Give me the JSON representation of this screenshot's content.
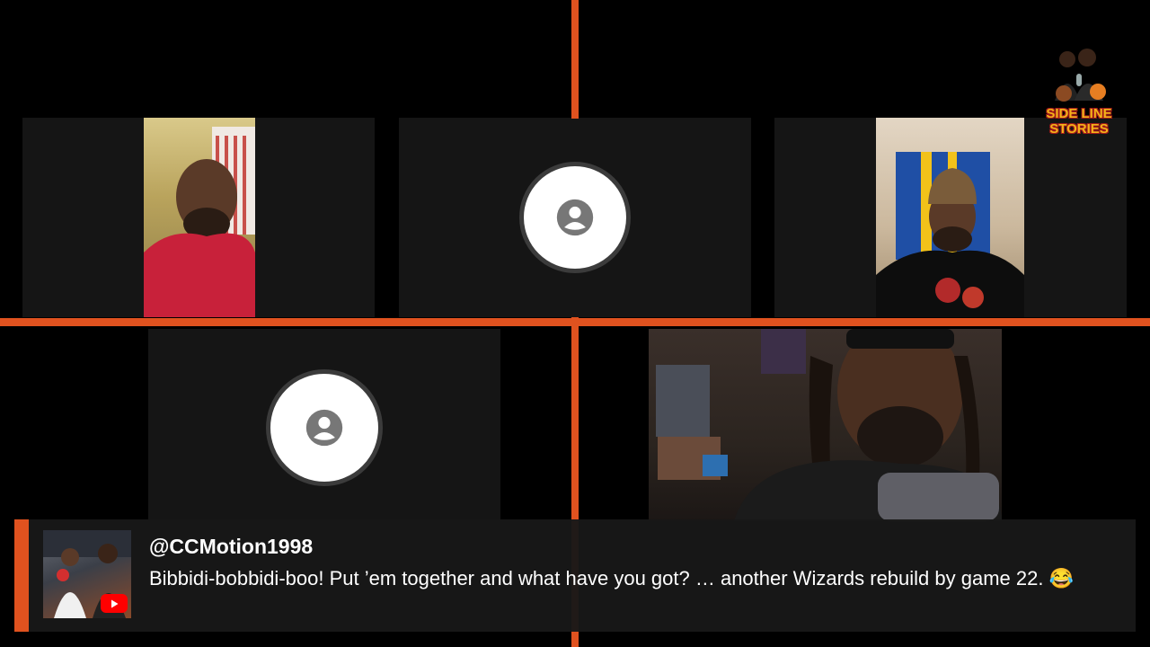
{
  "logo": {
    "line1": "SIDE LINE",
    "line2": "STORIES"
  },
  "participants": [
    {
      "id": "participant-1",
      "camera": true
    },
    {
      "id": "participant-2",
      "camera": false,
      "icon": "person-icon"
    },
    {
      "id": "participant-3",
      "camera": true
    },
    {
      "id": "participant-4",
      "camera": false,
      "icon": "person-icon"
    },
    {
      "id": "participant-5",
      "camera": true
    }
  ],
  "chat": {
    "author": "@CCMotion1998",
    "message": "Bibbidi-bobbidi-boo! Put ’em together and what have you got? … another Wizards rebuild by game 22. 😂",
    "badge_icon": "youtube-icon"
  },
  "colors": {
    "accent": "#e0521f",
    "tile": "#151515",
    "background": "#000000",
    "logo_text": "#f3b319"
  }
}
